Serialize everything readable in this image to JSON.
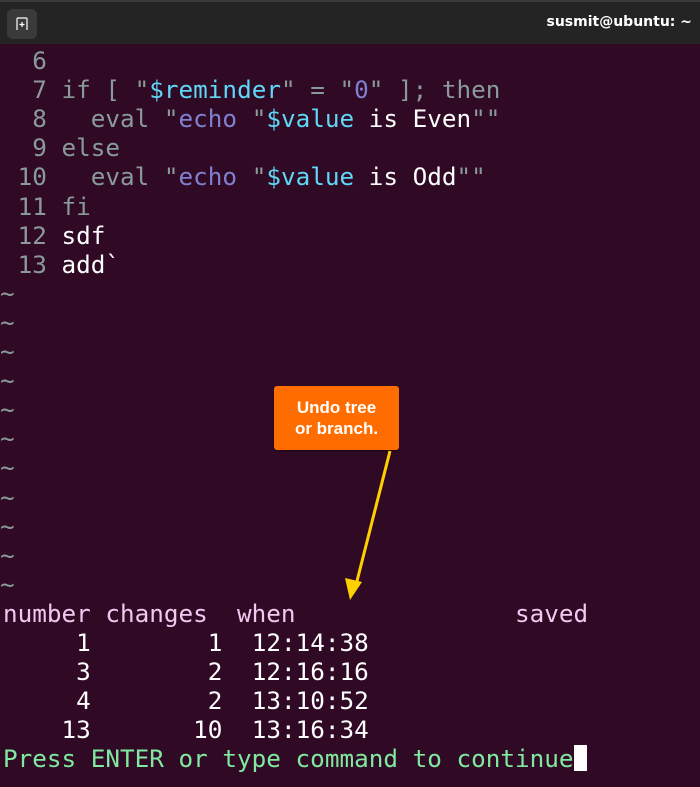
{
  "window": {
    "title": "susmit@ubuntu: ~",
    "new_tab_icon": "new-tab-icon"
  },
  "editor": {
    "lines": [
      {
        "num": "6",
        "segments": []
      },
      {
        "num": "7",
        "segments": [
          {
            "t": "if [ \"",
            "c": "kw"
          },
          {
            "t": "$reminder",
            "c": "var"
          },
          {
            "t": "\" = \"",
            "c": "kw"
          },
          {
            "t": "0",
            "c": "str"
          },
          {
            "t": "\" ]; then",
            "c": "kw"
          }
        ]
      },
      {
        "num": "8",
        "segments": [
          {
            "t": "  eval \"",
            "c": "kw"
          },
          {
            "t": "echo ",
            "c": "str"
          },
          {
            "t": "\"",
            "c": "kw"
          },
          {
            "t": "$value",
            "c": "var"
          },
          {
            "t": " is Even",
            "c": "plain"
          },
          {
            "t": "\"\"",
            "c": "kw"
          }
        ]
      },
      {
        "num": "9",
        "segments": [
          {
            "t": "else",
            "c": "kw"
          }
        ]
      },
      {
        "num": "10",
        "segments": [
          {
            "t": "  eval \"",
            "c": "kw"
          },
          {
            "t": "echo ",
            "c": "str"
          },
          {
            "t": "\"",
            "c": "kw"
          },
          {
            "t": "$value",
            "c": "var"
          },
          {
            "t": " is Odd",
            "c": "plain"
          },
          {
            "t": "\"\"",
            "c": "kw"
          }
        ]
      },
      {
        "num": "11",
        "segments": [
          {
            "t": "fi",
            "c": "kw"
          }
        ]
      },
      {
        "num": "12",
        "segments": [
          {
            "t": "sdf",
            "c": "plain"
          }
        ]
      },
      {
        "num": "13",
        "segments": [
          {
            "t": "add`",
            "c": "plain"
          }
        ]
      }
    ],
    "empty_line_marker": "~",
    "empty_line_count": 11
  },
  "undolist": {
    "header": "number changes  when               saved",
    "columns": [
      "number",
      "changes",
      "when",
      "saved"
    ],
    "rows": [
      {
        "number": "1",
        "changes": "1",
        "when": "12:14:38",
        "saved": ""
      },
      {
        "number": "3",
        "changes": "2",
        "when": "12:16:16",
        "saved": ""
      },
      {
        "number": "4",
        "changes": "2",
        "when": "13:10:52",
        "saved": ""
      },
      {
        "number": "13",
        "changes": "10",
        "when": "13:16:34",
        "saved": ""
      }
    ]
  },
  "prompt": {
    "text": "Press ENTER or type command to continue"
  },
  "annotation": {
    "text_line1": "Undo tree",
    "text_line2": "or branch.",
    "box_color": "#ff6d00",
    "arrow_color": "#ffd000"
  },
  "colors": {
    "background": "#300a24",
    "titlebar": "#242424",
    "line_number": "#8a9a9a",
    "variable": "#5fd7f7",
    "string": "#8080d0",
    "prompt": "#80e8a0",
    "header": "#f0c8f0"
  }
}
